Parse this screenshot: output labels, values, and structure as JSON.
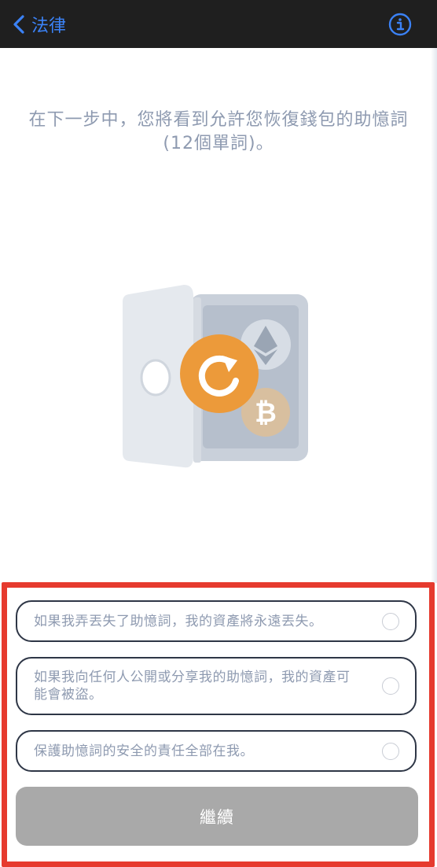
{
  "header": {
    "back_label": "法律",
    "back_icon": "chevron-left-icon",
    "info_icon": "info-circle-icon"
  },
  "description": "在下一步中，您將看到允許您恢復錢包的助憶詞 (12個單詞)。",
  "illustration": {
    "icons": [
      "safe-icon",
      "refresh-icon",
      "ethereum-icon",
      "bitcoin-icon"
    ]
  },
  "terms": [
    {
      "text": "如果我弄丟失了助憶詞，我的資產將永遠丟失。"
    },
    {
      "text": "如果我向任何人公開或分享我的助憶詞，我的資產可能會被盜。"
    },
    {
      "text": "保護助憶詞的安全的責任全部在我。"
    }
  ],
  "continue_label": "繼續",
  "colors": {
    "header_bg": "#1f1f1f",
    "accent": "#3b82f6",
    "highlight_frame": "#e63a2e",
    "button_disabled": "#a9a9a9",
    "text_muted": "#8e9ab0",
    "refresh_orange": "#ec9a3a"
  }
}
